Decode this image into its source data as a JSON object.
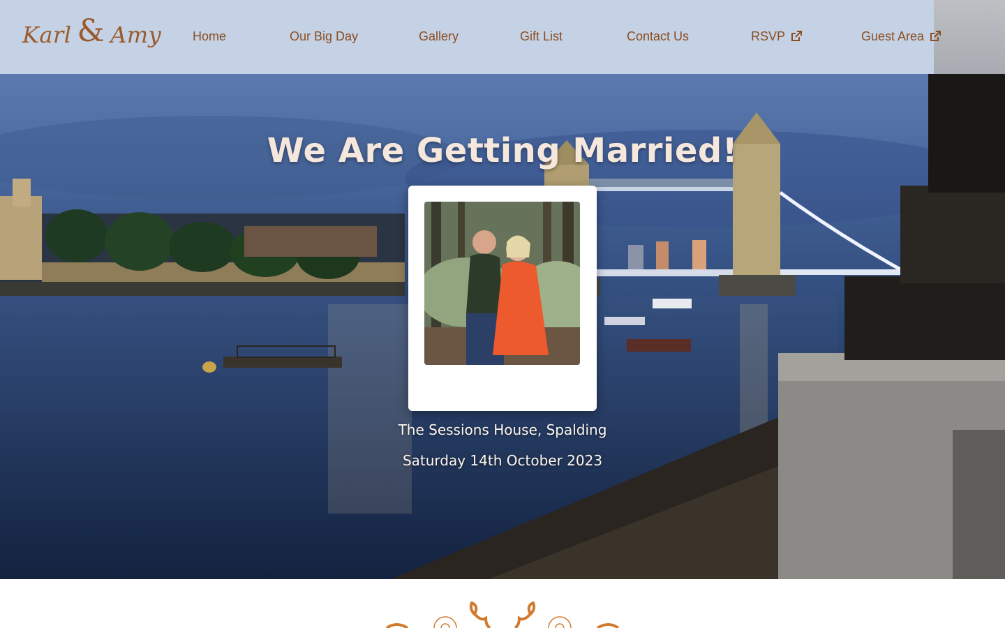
{
  "header": {
    "logo_text": {
      "first": "Karl",
      "amp": "&",
      "second": "Amy"
    },
    "nav": [
      {
        "label": "Home",
        "external": false
      },
      {
        "label": "Our Big Day",
        "external": false
      },
      {
        "label": "Gallery",
        "external": false
      },
      {
        "label": "Gift List",
        "external": false
      },
      {
        "label": "Contact Us",
        "external": false
      },
      {
        "label": "RSVP",
        "external": true,
        "icon": "external-link-icon"
      },
      {
        "label": "Guest Area",
        "external": true,
        "icon": "external-link-icon"
      }
    ]
  },
  "hero": {
    "title": "We Are Getting Married!",
    "venue": "The Sessions House, Spalding",
    "date": "Saturday 14th October 2023",
    "photo_icon": "couple-photo"
  },
  "colors": {
    "accent": "#8a4e22",
    "header_bg": "#c5d2e5",
    "title": "#f6e7dd"
  },
  "ornament_icon": "floral-divider-icon"
}
